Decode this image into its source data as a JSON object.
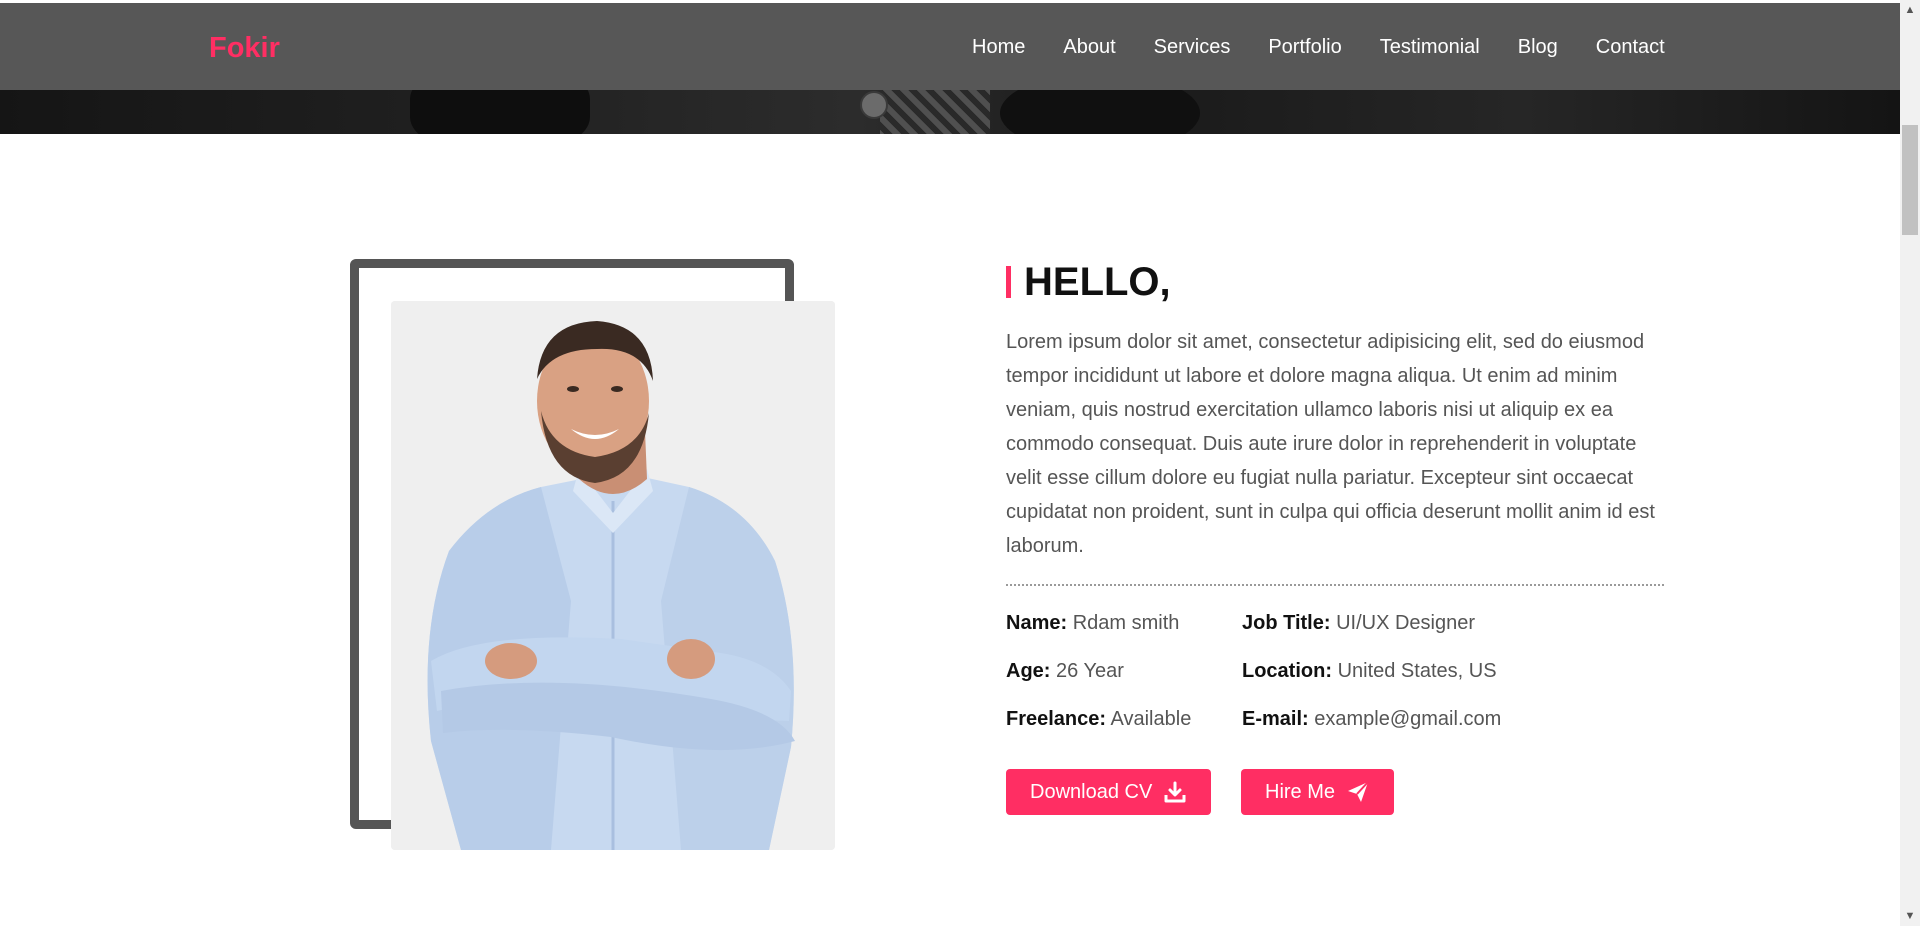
{
  "brand": {
    "logo": "Fokir",
    "accent_color": "#ff2e63"
  },
  "nav": {
    "items": [
      {
        "label": "Home"
      },
      {
        "label": "About"
      },
      {
        "label": "Services"
      },
      {
        "label": "Portfolio"
      },
      {
        "label": "Testimonial"
      },
      {
        "label": "Blog"
      },
      {
        "label": "Contact"
      }
    ]
  },
  "about": {
    "heading": "HELLO,",
    "paragraph": "Lorem ipsum dolor sit amet, consectetur adipisicing elit, sed do eiusmod tempor incididunt ut labore et dolore magna aliqua. Ut enim ad minim veniam, quis nostrud exercitation ullamco laboris nisi ut aliquip ex ea commodo consequat. Duis aute irure dolor in reprehenderit in voluptate velit esse cillum dolore eu fugiat nulla pariatur. Excepteur sint occaecat cupidatat non proident, sunt in culpa qui officia deserunt mollit anim id est laborum.",
    "info": {
      "name": {
        "label": "Name:",
        "value": "Rdam smith"
      },
      "job_title": {
        "label": "Job Title:",
        "value": "UI/UX Designer"
      },
      "age": {
        "label": "Age:",
        "value": "26 Year"
      },
      "location": {
        "label": "Location:",
        "value": "United States, US"
      },
      "freelance": {
        "label": "Freelance:",
        "value": "Available"
      },
      "email": {
        "label": "E-mail:",
        "value": "example@gmail.com"
      }
    },
    "buttons": {
      "download_cv": {
        "label": "Download CV",
        "icon": "download-icon"
      },
      "hire_me": {
        "label": "Hire Me",
        "icon": "paper-plane-icon"
      }
    }
  }
}
